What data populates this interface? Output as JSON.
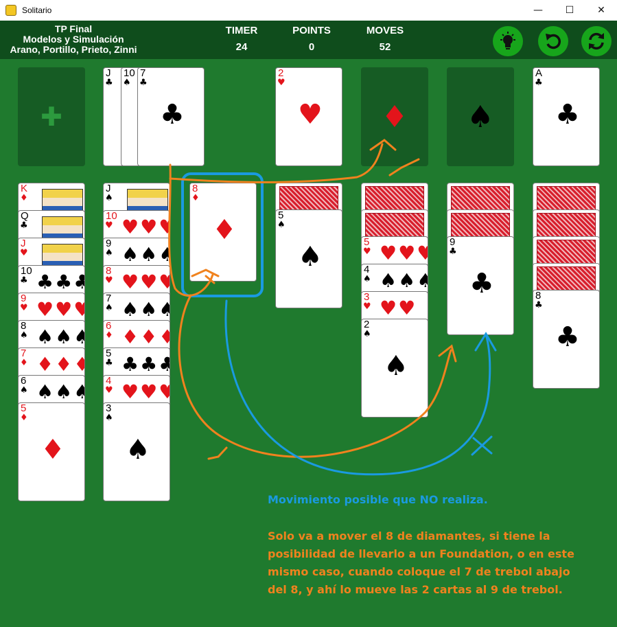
{
  "window": {
    "title": "Solitario",
    "controls": [
      "—",
      "☐",
      "✕"
    ]
  },
  "header": {
    "title_lines": [
      "TP Final",
      "Modelos y Simulación",
      "Arano, Portillo, Prieto, Zinni"
    ],
    "timer_label": "TIMER",
    "timer_value": "24",
    "points_label": "POINTS",
    "points_value": "0",
    "moves_label": "MOVES",
    "moves_value": "52",
    "buttons": [
      "hint-icon",
      "undo-icon",
      "restart-icon"
    ]
  },
  "colors": {
    "felt": "#1f7a2e",
    "header": "#0f4d1c",
    "slot": "#165c24",
    "button": "#17a51b",
    "red_suit": "#e3141b",
    "annotation_blue": "#1a9ae0",
    "annotation_orange": "#f0821e"
  },
  "stock": {
    "symbol": "✚"
  },
  "waste": [
    {
      "rank": "J",
      "suit": "♣"
    },
    {
      "rank": "10",
      "suit": "♠"
    },
    {
      "rank": "7",
      "suit": "♣"
    }
  ],
  "foundations": [
    {
      "rank": "2",
      "suit": "♥",
      "empty": false
    },
    {
      "suit": "♦",
      "empty": true
    },
    {
      "suit": "♠",
      "empty": true
    },
    {
      "rank": "A",
      "suit": "♣",
      "empty": false
    }
  ],
  "tableau": [
    {
      "hidden": 0,
      "cards": [
        [
          "K",
          "♦"
        ],
        [
          "Q",
          "♣"
        ],
        [
          "J",
          "♥"
        ],
        [
          "10",
          "♣"
        ],
        [
          "9",
          "♥"
        ],
        [
          "8",
          "♠"
        ],
        [
          "7",
          "♦"
        ],
        [
          "6",
          "♠"
        ],
        [
          "5",
          "♦"
        ]
      ]
    },
    {
      "hidden": 0,
      "cards": [
        [
          "J",
          "♠"
        ],
        [
          "10",
          "♥"
        ],
        [
          "9",
          "♠"
        ],
        [
          "8",
          "♥"
        ],
        [
          "7",
          "♠"
        ],
        [
          "6",
          "♦"
        ],
        [
          "5",
          "♣"
        ],
        [
          "4",
          "♥"
        ],
        [
          "3",
          "♠"
        ]
      ]
    },
    {
      "hidden": 0,
      "cards": [
        [
          "8",
          "♦"
        ]
      ]
    },
    {
      "hidden": 1,
      "cards": [
        [
          "5",
          "♠"
        ]
      ]
    },
    {
      "hidden": 2,
      "cards": [
        [
          "5",
          "♥"
        ],
        [
          "4",
          "♠"
        ],
        [
          "3",
          "♥"
        ],
        [
          "2",
          "♠"
        ]
      ]
    },
    {
      "hidden": 2,
      "cards": [
        [
          "9",
          "♣"
        ]
      ]
    },
    {
      "hidden": 4,
      "cards": [
        [
          "8",
          "♣"
        ]
      ]
    }
  ],
  "annotations": {
    "blue_text": "Movimiento posible que NO realiza.",
    "orange_lines": [
      "Solo va a mover el 8 de diamantes, si tiene la",
      "posibilidad de llevarlo a un Foundation, o en este",
      "mismo caso, cuando coloque el 7 de trebol abajo",
      "del 8, y ahí lo mueve las 2 cartas al 9 de trebol."
    ]
  }
}
